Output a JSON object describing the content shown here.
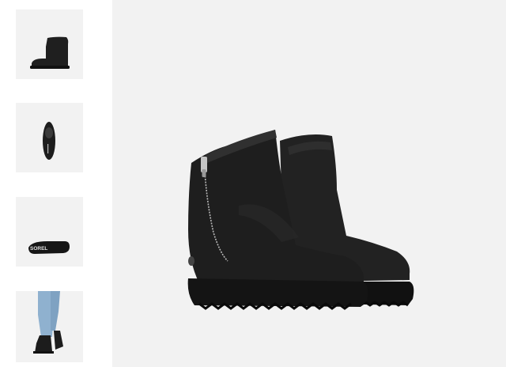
{
  "gallery": {
    "thumbnails": [
      {
        "view": "side-view",
        "selected": true
      },
      {
        "view": "top-view",
        "selected": false
      },
      {
        "view": "sole-view",
        "selected": false
      },
      {
        "view": "on-model-view",
        "selected": false
      }
    ],
    "sole_brand_text": "SOREL"
  },
  "colors": {
    "background": "#f2f2f2",
    "boot": "#1c1c1c",
    "boot_highlight": "#3a3a3a",
    "zipper": "#b8b8b8",
    "denim": "#8fb1cf"
  }
}
